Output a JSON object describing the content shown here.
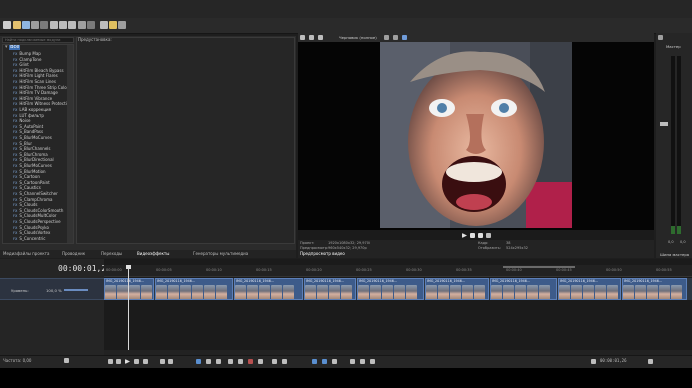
{
  "fx_panel": {
    "search_placeholder": "Найти подключаемые модули",
    "root": "Все",
    "preview_label": "Предустановка:",
    "tag": "FX",
    "items": [
      "Bump Map",
      "ClampTone",
      "Glint",
      "HitFilm Bleach Bypass",
      "HitFilm Light Flares",
      "HitFilm Scan Lines",
      "HitFilm Three Strip Color",
      "HitFilm TV Damage",
      "HitFilm Vibrance",
      "HitFilm Witness Protection",
      "LAB коррекция",
      "LUT фильтр",
      "Noise",
      "S_AutoPaint",
      "S_BandPass",
      "S_BlurMoCurves",
      "S_Blur",
      "S_BlurChannels",
      "S_BlurChroma",
      "S_BlurDirectional",
      "S_BlurMoCurves",
      "S_BlurMotion",
      "S_Cartoon",
      "S_CartoonPaint",
      "S_Caustics",
      "S_ChannelSwitcher",
      "S_ClampChroma",
      "S_Clouds",
      "S_CloudsColorSmooth",
      "S_CloudsMultColor",
      "S_CloudsPerspective",
      "S_CloudsPsyko",
      "S_CloudsVortex",
      "S_Concentric"
    ]
  },
  "tabs_left": [
    "Медиафайлы проекта",
    "Проводник",
    "Переходы",
    "Видеоэффекты",
    "Генераторы мультимедиа"
  ],
  "preview": {
    "quality": "Черновик (полное)",
    "project_label": "Проект:",
    "project_value": "1920x1080x32; 29,970i",
    "preview_label": "Предпросмотр:",
    "preview_value": "960x540x32; 29,970p",
    "frame_label": "Кадр:",
    "frame_value": "38",
    "display_label": "Отобразить:",
    "display_value": "524x295x32",
    "tab": "Предпросмотр видео"
  },
  "master": {
    "label": "Мастер",
    "value_left": "0,0",
    "value_right": "0,0",
    "tab": "Шина мастера"
  },
  "timeline": {
    "timecode": "00:00:01,26",
    "track_name": "Уровень:",
    "track_level": "100,0 %",
    "ruler": [
      "00:00:00",
      "00:00:05",
      "00:00:10",
      "00:00:15",
      "00:00:20",
      "00:00:25",
      "00:00:30",
      "00:00:35",
      "00:00:40",
      "00:00:45",
      "00:00:50",
      "00:00:55"
    ],
    "clip_name": "IMG_20190116_1946..."
  },
  "status": {
    "rate": "Частота: 0,00",
    "end_timecode": "00:00:01,26",
    "record_time": "Время записи (2 каналов): 244:25:50"
  }
}
